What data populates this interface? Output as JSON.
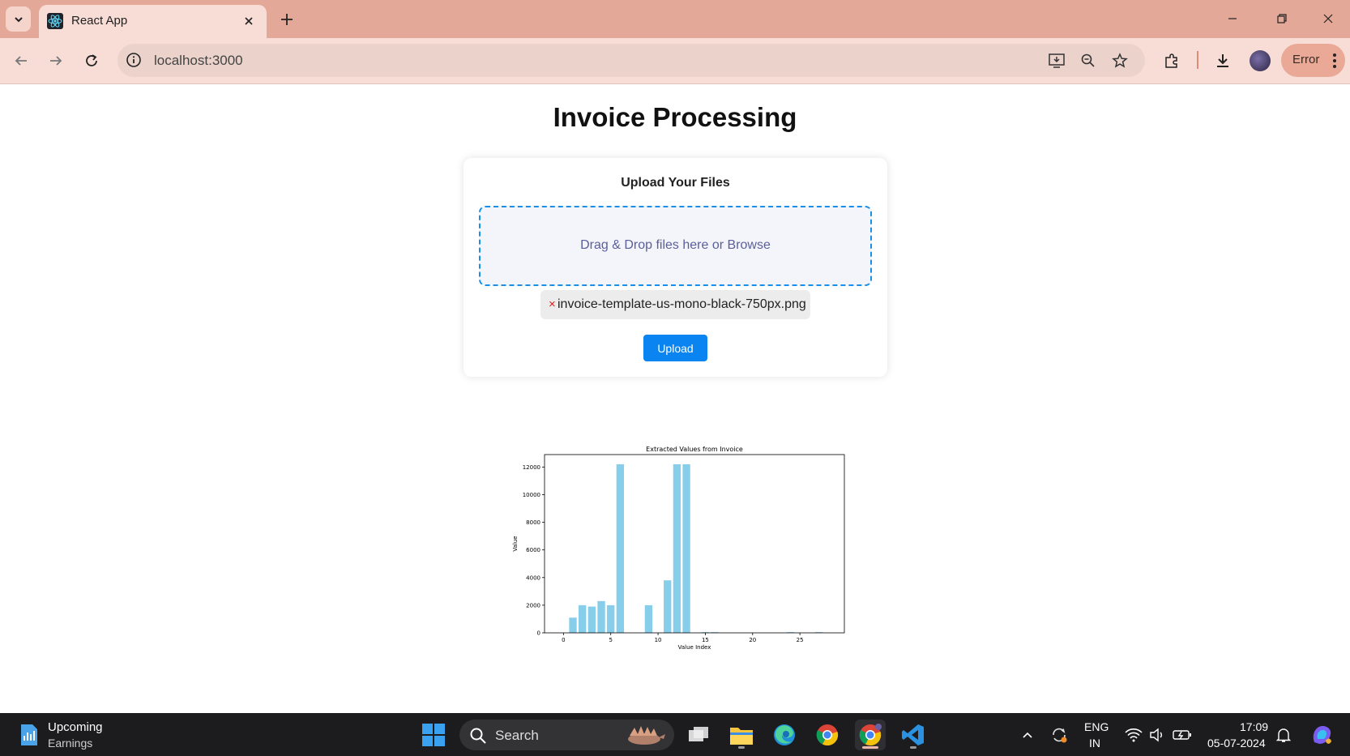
{
  "browser": {
    "tab_title": "React App",
    "url": "localhost:3000",
    "profile_status": "Error"
  },
  "page": {
    "title": "Invoice Processing",
    "card_heading": "Upload Your Files",
    "dropzone_text": "Drag & Drop files here or Browse",
    "file": {
      "remove_glyph": "×",
      "name": "invoice-template-us-mono-black-750px.png"
    },
    "upload_button": "Upload"
  },
  "chart_data": {
    "type": "bar",
    "title": "Extracted Values from Invoice",
    "xlabel": "Value Index",
    "ylabel": "Value",
    "x": [
      0,
      1,
      2,
      3,
      4,
      5,
      6,
      7,
      8,
      9,
      10,
      11,
      12,
      13,
      14,
      15,
      16,
      17,
      18,
      19,
      20,
      21,
      22,
      23,
      24,
      25,
      26,
      27
    ],
    "values": [
      0,
      1100,
      2000,
      1900,
      2300,
      2000,
      12200,
      0,
      0,
      2000,
      0,
      3800,
      12200,
      12200,
      0,
      50,
      50,
      0,
      0,
      0,
      0,
      0,
      0,
      0,
      50,
      0,
      0,
      50
    ],
    "xlim": [
      -2,
      29.7
    ],
    "ylim": [
      0,
      12900
    ],
    "xticks": [
      0,
      5,
      10,
      15,
      20,
      25
    ],
    "yticks": [
      0,
      2000,
      4000,
      6000,
      8000,
      10000,
      12000
    ],
    "bar_color": "#87ceeb",
    "grid": false
  },
  "taskbar": {
    "widget_title": "Upcoming",
    "widget_subtitle": "Earnings",
    "search_label": "Search",
    "lang_line1": "ENG",
    "lang_line2": "IN",
    "time": "17:09",
    "date": "05-07-2024"
  }
}
